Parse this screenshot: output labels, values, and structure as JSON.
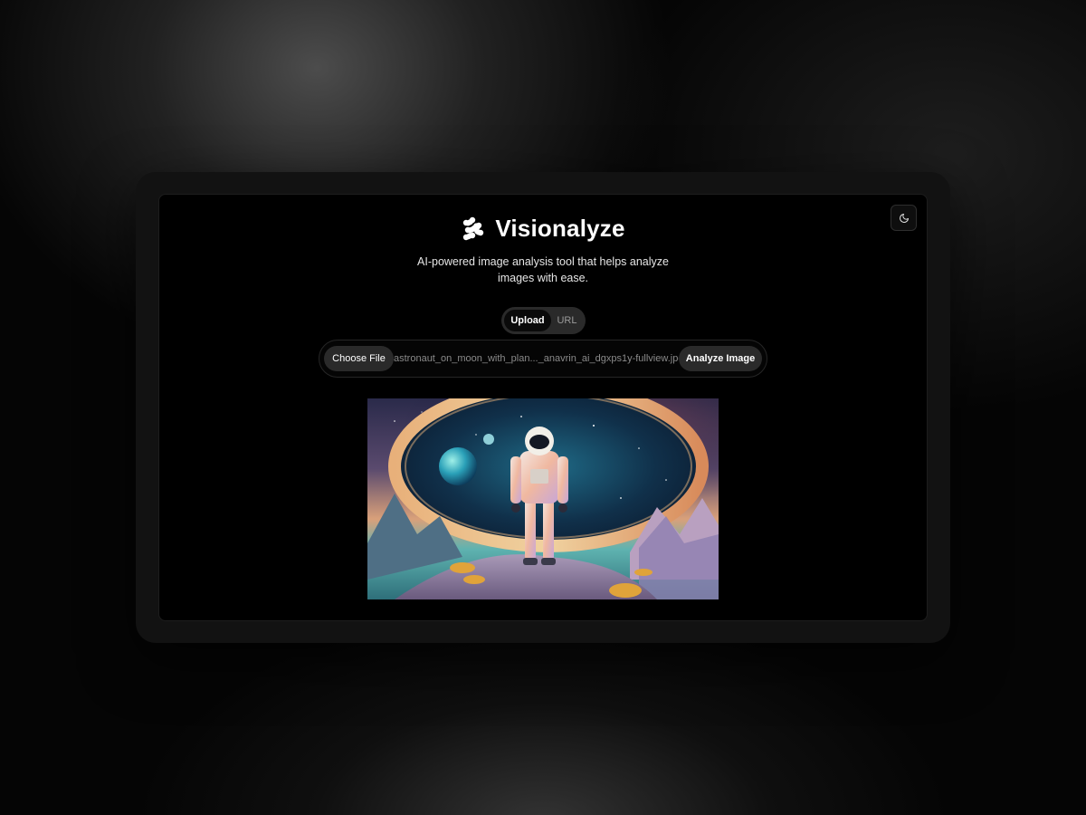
{
  "app": {
    "title": "Visionalyze",
    "subtitle": "AI-powered image analysis tool that helps analyze images with ease."
  },
  "theme_toggle": {
    "icon": "moon-icon"
  },
  "tabs": [
    {
      "label": "Upload",
      "active": true
    },
    {
      "label": "URL",
      "active": false
    }
  ],
  "upload": {
    "choose_label": "Choose File",
    "file_name": "astronaut_on_moon_with_plan..._anavrin_ai_dgxps1y-fullview.jpg",
    "analyze_label": "Analyze Image"
  },
  "preview": {
    "icon": "astronaut-image"
  },
  "colors": {
    "background": "#000000",
    "frame": "#121212",
    "button": "#2a2a2a",
    "accent_text": "#ffffff"
  }
}
